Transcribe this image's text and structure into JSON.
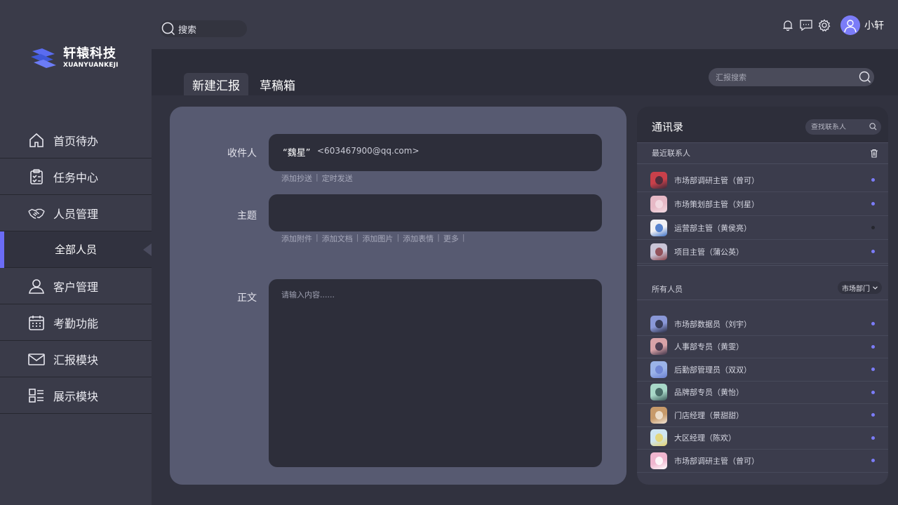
{
  "brand": {
    "name_cn": "轩辕科技",
    "name_en": "XUANYUANKEJI"
  },
  "nav": {
    "items": [
      {
        "label": "首页待办",
        "icon": "home-icon"
      },
      {
        "label": "任务中心",
        "icon": "clipboard-icon"
      },
      {
        "label": "人员管理",
        "icon": "handshake-icon"
      }
    ],
    "active_sub": "全部人员",
    "items_after": [
      {
        "label": "客户管理",
        "icon": "user-icon"
      },
      {
        "label": "考勤功能",
        "icon": "calendar-icon"
      },
      {
        "label": "汇报模块",
        "icon": "mail-icon"
      },
      {
        "label": "展示模块",
        "icon": "dashboard-icon"
      }
    ]
  },
  "topbar": {
    "search_label": "搜索",
    "user_name": "小轩"
  },
  "tabs": {
    "new_report": "新建汇报",
    "drafts": "草稿箱"
  },
  "report_search": {
    "placeholder": "汇报搜索"
  },
  "compose": {
    "recipient_label": "收件人",
    "recipient_name": "“魏星”",
    "recipient_email": "<603467900@qq.com>",
    "recipient_links": [
      "添加抄送",
      "定时发送"
    ],
    "subject_label": "主题",
    "subject_links": [
      "添加附件",
      "添加文档",
      "添加图片",
      "添加表情",
      "更多"
    ],
    "body_label": "正文",
    "body_placeholder": "请输入内容......"
  },
  "contacts": {
    "title": "通讯录",
    "search_placeholder": "查找联系人",
    "recent_label": "最近联系人",
    "recent": [
      {
        "name": "市场部调研主管（曾可）",
        "status": "online"
      },
      {
        "name": "市场策划部主管（刘星）",
        "status": "online"
      },
      {
        "name": "运营部主管（黄侯亮）",
        "status": "offline"
      },
      {
        "name": "项目主管（蒲公英）",
        "status": "online"
      }
    ],
    "all_label": "所有人员",
    "dept_filter": "市场部门",
    "all": [
      {
        "name": "市场部数据员（刘宇）",
        "status": "online"
      },
      {
        "name": "人事部专员（黄雯）",
        "status": "online"
      },
      {
        "name": "后勤部管理员（双双）",
        "status": "online"
      },
      {
        "name": "品牌部专员（黄怡）",
        "status": "online"
      },
      {
        "name": "门店经理（景甜甜）",
        "status": "online"
      },
      {
        "name": "大区经理（陈欢）",
        "status": "online"
      },
      {
        "name": "市场部调研主管（曾可）",
        "status": "online"
      }
    ]
  },
  "colors": {
    "accent": "#6b6cf6",
    "online_dot": "#7b7cf8",
    "offline_dot": "#26272f"
  }
}
